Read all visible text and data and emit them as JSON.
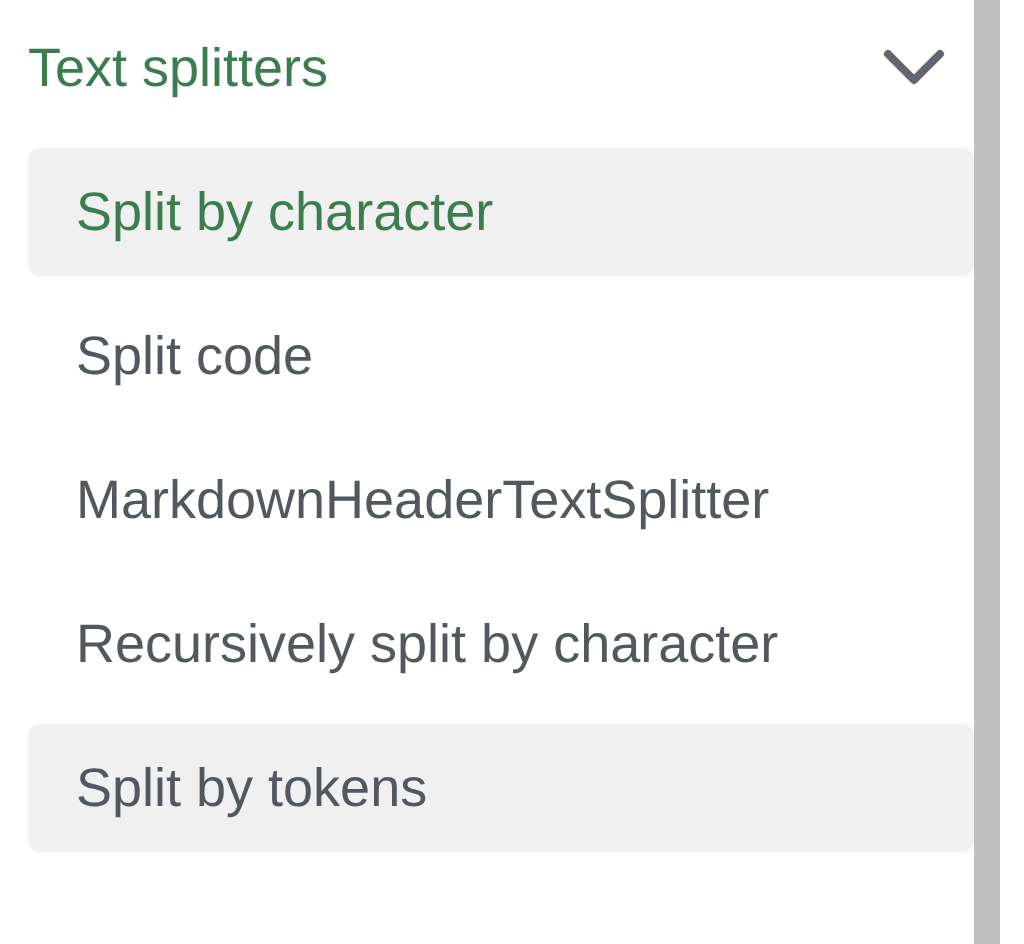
{
  "section": {
    "title": "Text splitters",
    "expanded": true
  },
  "items": [
    {
      "label": "Split by character",
      "selected": true,
      "hovered": false
    },
    {
      "label": "Split code",
      "selected": false,
      "hovered": false
    },
    {
      "label": "MarkdownHeaderTextSplitter",
      "selected": false,
      "hovered": false
    },
    {
      "label": "Recursively split by character",
      "selected": false,
      "hovered": false
    },
    {
      "label": "Split by tokens",
      "selected": false,
      "hovered": true
    }
  ]
}
